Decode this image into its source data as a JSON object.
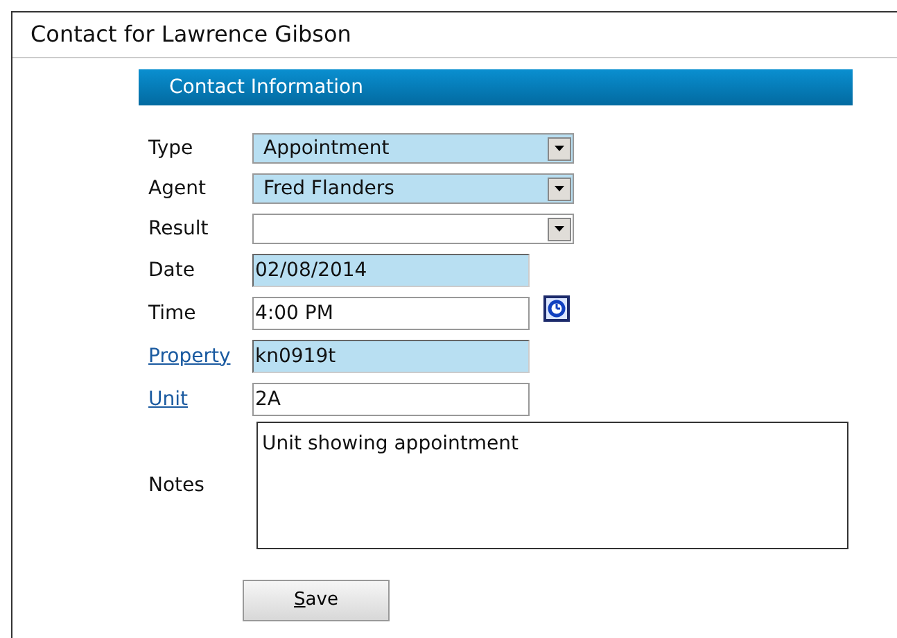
{
  "title": "Contact for Lawrence Gibson",
  "section": {
    "title": "Contact Information"
  },
  "fields": [
    {
      "label": "Type",
      "link": false,
      "kind": "select",
      "value": "Appointment",
      "highlighted": true
    },
    {
      "label": "Agent",
      "link": false,
      "kind": "select",
      "value": "Fred Flanders",
      "highlighted": true
    },
    {
      "label": "Result",
      "link": false,
      "kind": "select",
      "highlighted": false
    },
    {
      "label": "Date",
      "link": false,
      "kind": "text",
      "value": "02/08/2014",
      "highlighted": true
    },
    {
      "label": "Time",
      "link": false,
      "kind": "text",
      "value": "4:00 PM",
      "highlighted": false,
      "time_picker": true
    },
    {
      "label": "Property",
      "link": true,
      "kind": "text",
      "value": "kn0919t",
      "highlighted": true
    },
    {
      "label": "Unit",
      "link": true,
      "kind": "text",
      "value": "2A",
      "highlighted": false
    },
    {
      "label": "Notes",
      "link": false,
      "kind": "textarea",
      "value": "Unit showing appointment",
      "highlighted": false
    }
  ],
  "save_button": {
    "mnemonic": "S",
    "rest": "ave"
  }
}
